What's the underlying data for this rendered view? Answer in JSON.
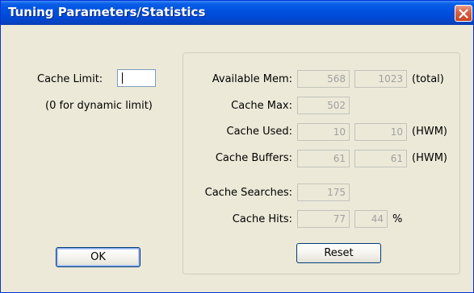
{
  "window": {
    "title": "Tuning Parameters/Statistics"
  },
  "cache_limit": {
    "label": "Cache Limit:",
    "value": "",
    "note": "(0 for dynamic limit)"
  },
  "stats": {
    "available_mem": {
      "label": "Available Mem:",
      "value": "568",
      "total": "1023",
      "suffix": "(total)"
    },
    "cache_max": {
      "label": "Cache Max:",
      "value": "502"
    },
    "cache_used": {
      "label": "Cache Used:",
      "value": "10",
      "hwm": "10",
      "suffix": "(HWM)"
    },
    "cache_buffers": {
      "label": "Cache Buffers:",
      "value": "61",
      "hwm": "61",
      "suffix": "(HWM)"
    },
    "cache_searches": {
      "label": "Cache Searches:",
      "value": "175"
    },
    "cache_hits": {
      "label": "Cache Hits:",
      "value": "77",
      "percent": "44",
      "suffix": "%"
    }
  },
  "buttons": {
    "ok": "OK",
    "reset": "Reset"
  },
  "icons": {
    "close": "close-icon"
  },
  "colors": {
    "titlebar": "#0052e0",
    "dialog_bg": "#ece9d8",
    "close_button": "#d8674a"
  }
}
